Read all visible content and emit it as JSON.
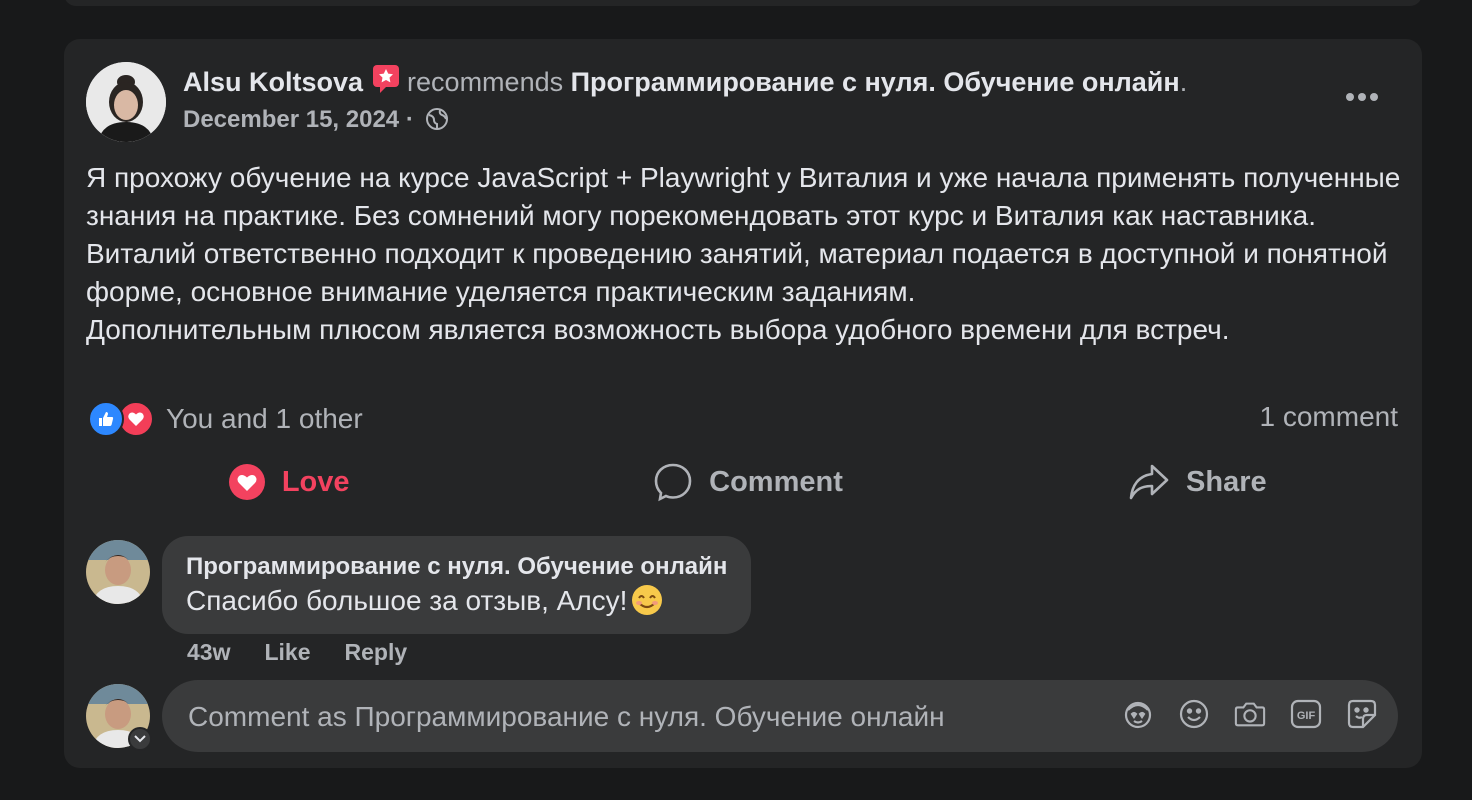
{
  "post": {
    "author": "Alsu Koltsova",
    "verb": "recommends",
    "page": "Программирование с нуля. Обучение онлайн",
    "period": ".",
    "date": "December 15, 2024",
    "date_sep": "·",
    "text_lines": [
      "Я прохожу обучение на курсе JavaScript + Playwright у Виталия и уже начала применять полученные знания на практике. Без сомнений могу порекомендовать этот курс и Виталия как наставника.",
      "Виталий ответственно подходит к проведению занятий, материал подается в доступной и понятной форме, основное внимание уделяется практическим заданиям.",
      "Дополнительным плюсом является возможность выбора удобного времени для встреч."
    ],
    "reactions_text": "You and 1 other",
    "comments_count": "1 comment"
  },
  "actions": {
    "love": "Love",
    "comment": "Comment",
    "share": "Share"
  },
  "comment": {
    "author": "Программирование с нуля. Обучение онлайн",
    "text": "Спасибо большое за отзыв, Алсу!",
    "time": "43w",
    "like": "Like",
    "reply": "Reply"
  },
  "composer": {
    "placeholder": "Comment as Программирование с нуля. Обучение онлайн"
  },
  "icons": [
    "recommend-star-icon",
    "globe-icon",
    "more-icon",
    "like-icon",
    "love-icon",
    "comment-icon",
    "share-icon",
    "smile-emoji-icon",
    "chevron-down-icon",
    "avatar-sticker-icon",
    "emoji-icon",
    "camera-icon",
    "gif-icon",
    "sticker-icon"
  ],
  "colors": {
    "background": "#18191a",
    "card": "#242526",
    "bubble": "#3a3b3c",
    "love": "#f3425f",
    "like": "#2d88ff",
    "secondary_text": "#b0b3b8"
  }
}
